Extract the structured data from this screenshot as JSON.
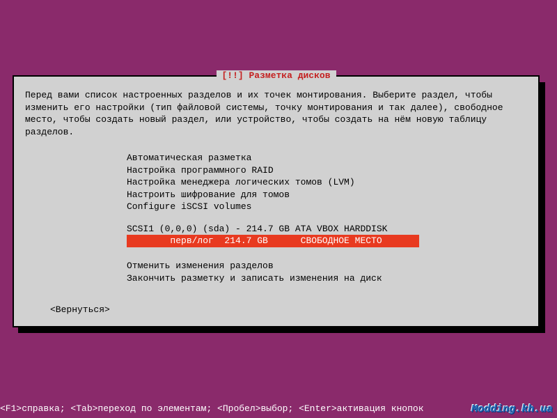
{
  "dialog": {
    "title": "[!!] Разметка дисков",
    "intro": "Перед вами список настроенных разделов и их точек монтирования. Выберите раздел, чтобы изменить его настройки (тип файловой системы, точку монтирования и так далее), свободное место, чтобы создать новый раздел, или устройство, чтобы создать на нём новую таблицу разделов.",
    "menu": {
      "auto_partition": "Автоматическая разметка",
      "raid": "Настройка программного RAID",
      "lvm": "Настройка менеджера логических томов (LVM)",
      "encrypt": "Настроить шифрование для томов",
      "iscsi": "Configure iSCSI volumes"
    },
    "disk": {
      "header": "SCSI1 (0,0,0) (sda) - 214.7 GB ATA VBOX HARDDISK",
      "free_space_row": "        перв/лог  214.7 GB      СВОБОДНОЕ МЕСТО"
    },
    "actions": {
      "undo": "Отменить изменения разделов",
      "finish": "Закончить разметку и записать изменения на диск"
    },
    "back": "<Вернуться>"
  },
  "helpbar": "<F1>справка; <Tab>переход по элементам; <Пробел>выбор; <Enter>активация кнопок",
  "watermark": "Modding.kh.ua"
}
